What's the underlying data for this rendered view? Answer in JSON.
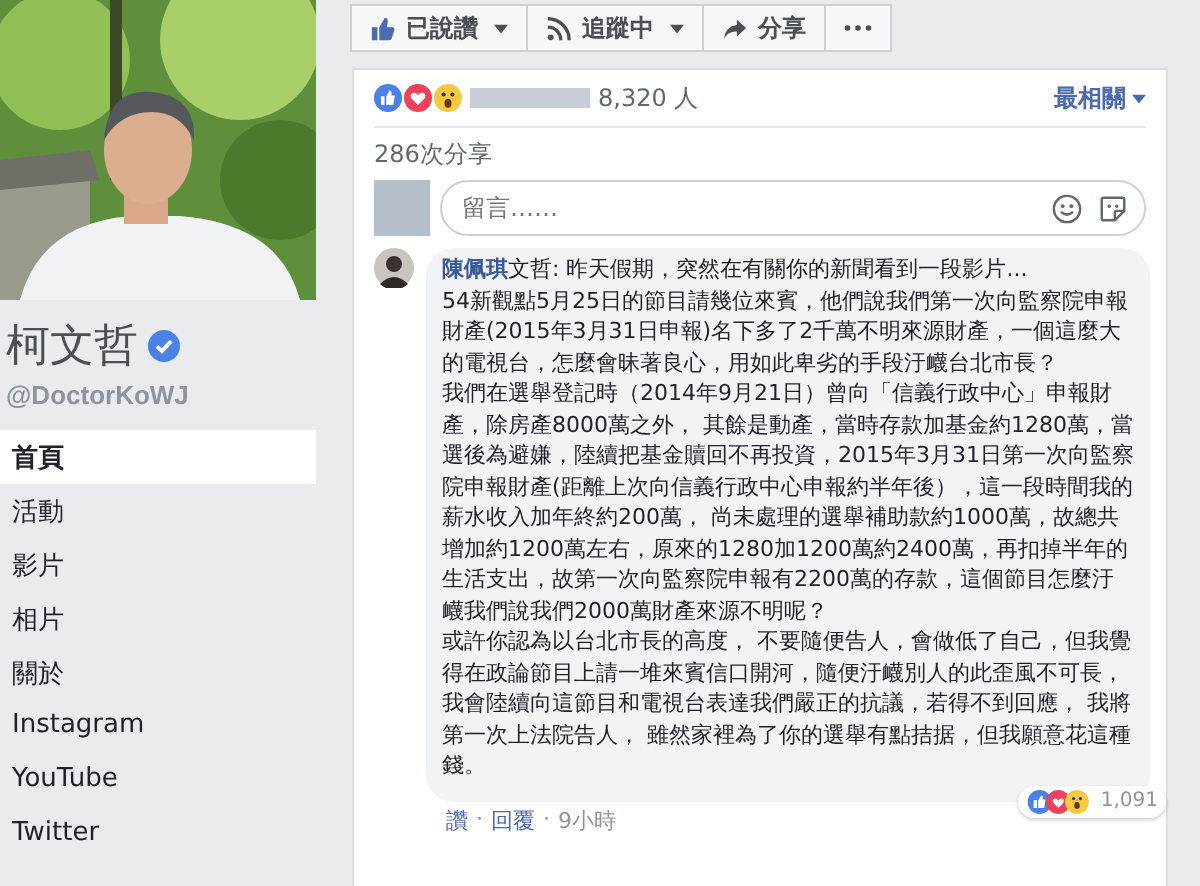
{
  "profile": {
    "name": "柯文哲",
    "verified": true,
    "handle": "@DoctorKoWJ"
  },
  "nav": [
    {
      "label": "首頁",
      "selected": true
    },
    {
      "label": "活動",
      "selected": false
    },
    {
      "label": "影片",
      "selected": false
    },
    {
      "label": "相片",
      "selected": false
    },
    {
      "label": "關於",
      "selected": false
    },
    {
      "label": "Instagram",
      "selected": false
    },
    {
      "label": "YouTube",
      "selected": false
    },
    {
      "label": "Twitter",
      "selected": false
    }
  ],
  "actions": [
    {
      "kind": "like",
      "label": "已說讚",
      "dropdown": true
    },
    {
      "kind": "follow",
      "label": "追蹤中",
      "dropdown": true
    },
    {
      "kind": "share",
      "label": "分享",
      "dropdown": false
    },
    {
      "kind": "more"
    }
  ],
  "post": {
    "reaction_count": "8,320 人",
    "sort": "最相關",
    "shares": "286次分享",
    "comment_placeholder": "留言……",
    "comment": {
      "author": "陳佩琪",
      "paragraphs": [
        "文哲: 昨天假期，突然在有關你的新聞看到一段影片...",
        "54新觀點5月25日的節目請幾位來賓，他們說我們第一次向監察院申報財產(2015年3月31日申報)名下多了2千萬不明來源財產，一個這麼大的電視台，怎麼會昧著良心，用如此卑劣的手段汙衊台北市長？",
        "我們在選舉登記時（2014年9月21日）曾向「信義行政中心」申報財產，除房產8000萬之外， 其餘是動產，當時存款加基金約1280萬，當選後為避嫌，陸續把基金贖回不再投資，2015年3月31日第一次向監察院申報財產(距離上次向信義行政中心申報約半年後），這一段時間我的薪水收入加年終約200萬， 尚未處理的選舉補助款約1000萬，故總共增加約1200萬左右，原來的1280加1200萬約2400萬，再扣掉半年的生活支出，故第一次向監察院申報有2200萬的存款，這個節目怎麼汙衊我們說我們2000萬財產來源不明呢？",
        "或許你認為以台北市長的高度， 不要隨便告人，會做低了自己，但我覺得在政論節目上請一堆來賓信口開河，隨便汙衊別人的此歪風不可長，我會陸續向這節目和電視台表達我們嚴正的抗議，若得不到回應， 我將第一次上法院告人， 雖然家裡為了你的選舉有點拮据，但我願意花這種錢。"
      ],
      "reactions": "1,091",
      "separator": "·",
      "like": "讚",
      "reply": "回覆",
      "time": "9小時"
    }
  }
}
